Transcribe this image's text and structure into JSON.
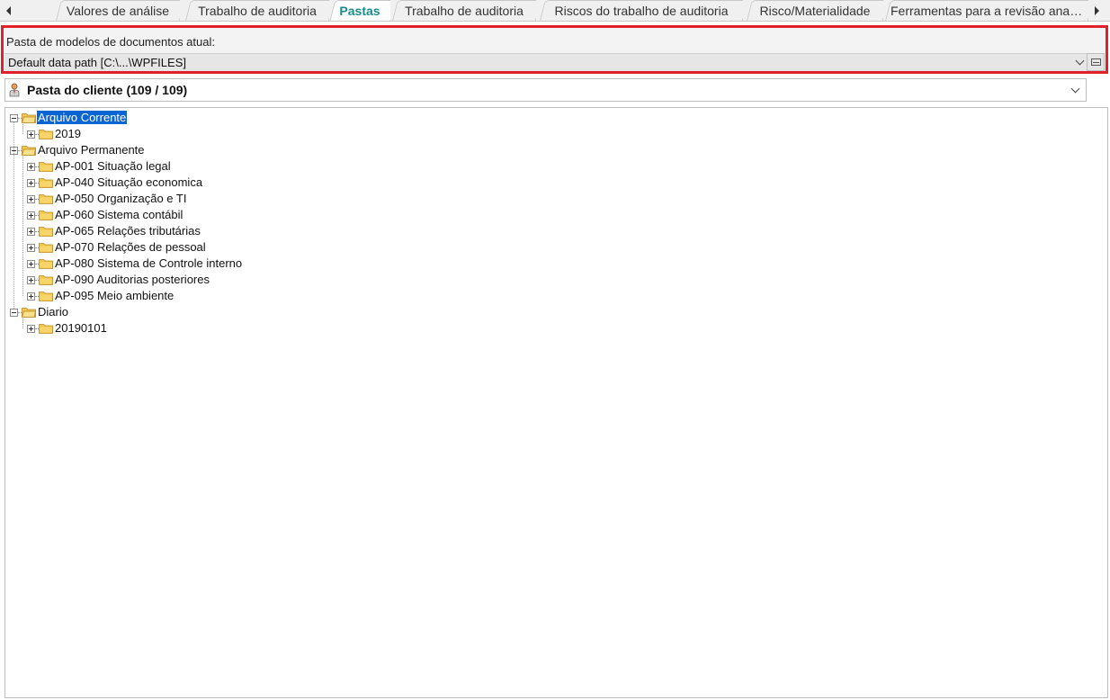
{
  "tabs": {
    "items": [
      {
        "label": "Valores de análise"
      },
      {
        "label": "Trabalho de auditoria"
      },
      {
        "label": "Pastas",
        "active": true
      },
      {
        "label": "Trabalho de auditoria"
      },
      {
        "label": "Riscos do trabalho de auditoria"
      },
      {
        "label": "Risco/Materialidade"
      },
      {
        "label": "Ferramentas para a revisão analít..."
      }
    ],
    "active_color": "#1a8a8a"
  },
  "template_folder": {
    "label": "Pasta de modelos de documentos atual:",
    "value": "Default data path [C:\\...\\WPFILES]",
    "highlight_color": "#e0202a"
  },
  "client_folder": {
    "label": "Pasta do cliente (109 / 109)",
    "icon": "client-person-icon"
  },
  "tree": {
    "selection_color": "#0a64d2",
    "nodes": [
      {
        "label": "Arquivo Corrente",
        "level": 0,
        "expanded": true,
        "selected": true
      },
      {
        "label": "2019",
        "level": 1,
        "expanded": false
      },
      {
        "label": "Arquivo Permanente",
        "level": 0,
        "expanded": true
      },
      {
        "label": "AP-001 Situação legal",
        "level": 1,
        "expanded": false
      },
      {
        "label": "AP-040 Situação economica",
        "level": 1,
        "expanded": false
      },
      {
        "label": "AP-050 Organização e TI",
        "level": 1,
        "expanded": false
      },
      {
        "label": "AP-060 Sistema contábil",
        "level": 1,
        "expanded": false
      },
      {
        "label": "AP-065 Relações tributárias",
        "level": 1,
        "expanded": false
      },
      {
        "label": "AP-070 Relações de pessoal",
        "level": 1,
        "expanded": false
      },
      {
        "label": "AP-080 Sistema de Controle interno",
        "level": 1,
        "expanded": false
      },
      {
        "label": "AP-090 Auditorias posteriores",
        "level": 1,
        "expanded": false
      },
      {
        "label": "AP-095 Meio ambiente",
        "level": 1,
        "expanded": false
      },
      {
        "label": "Diario",
        "level": 0,
        "expanded": true
      },
      {
        "label": "20190101",
        "level": 1,
        "expanded": false
      }
    ]
  }
}
